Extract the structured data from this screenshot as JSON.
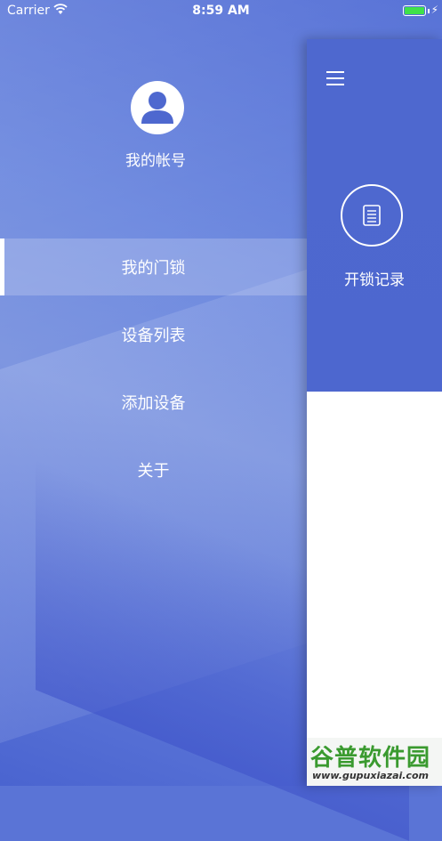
{
  "status_bar": {
    "carrier": "Carrier",
    "time": "8:59 AM",
    "battery_color": "#3fe14a"
  },
  "drawer": {
    "avatar_icon": "user-avatar-icon",
    "account_label": "我的帐号",
    "items": [
      {
        "label": "我的门锁",
        "active": true
      },
      {
        "label": "设备列表",
        "active": false
      },
      {
        "label": "添加设备",
        "active": false
      },
      {
        "label": "关于",
        "active": false
      }
    ]
  },
  "main": {
    "menu_icon": "hamburger-icon",
    "record_icon": "document-icon",
    "record_label": "开锁记录",
    "header_color": "#4e68cf"
  },
  "watermark": {
    "title": "谷普软件园",
    "url": "www.gupuxiazai.com"
  }
}
